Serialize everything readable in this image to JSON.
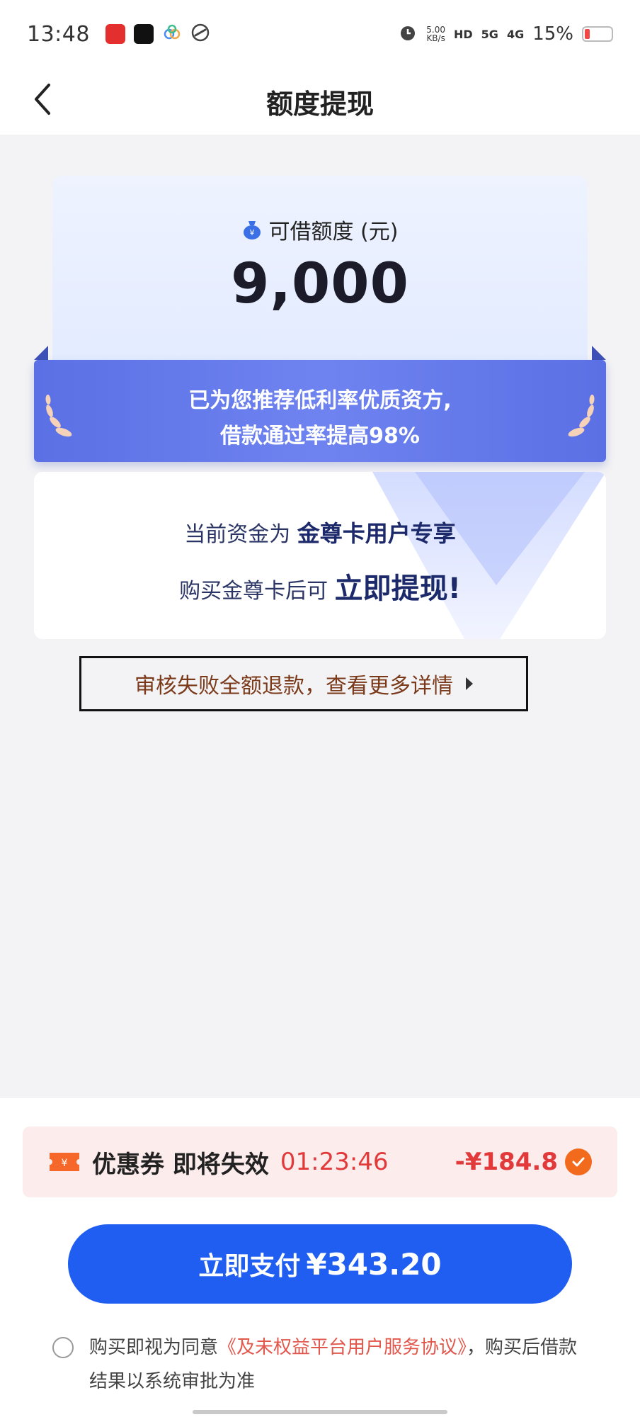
{
  "status_bar": {
    "time": "13:48",
    "net_speed_value": "5.00",
    "net_speed_unit": "KB/s",
    "hd_label": "HD",
    "sig1_label": "5G",
    "sig2_label": "4G",
    "battery_percent": "15%",
    "battery_level": 0.15,
    "apps": [
      "xiaohongshu-app-icon",
      "douyin-app-icon",
      "cloud-app-icon",
      "link-app-icon"
    ]
  },
  "header": {
    "title": "额度提现"
  },
  "limit_card": {
    "label": "可借额度 (元)",
    "amount": "9,000"
  },
  "ribbon": {
    "line1": "已为您推荐低利率优质资方,",
    "line2": "借款通过率提高98%"
  },
  "promo": {
    "line1_prefix": "当前资金为",
    "line1_highlight": "金尊卡用户专享",
    "line2_prefix": "购买金尊卡后可",
    "line2_highlight": "立即提现!"
  },
  "refund_link": {
    "label": "审核失败全额退款，查看更多详情"
  },
  "coupon": {
    "label": "优惠券 即将失效",
    "timer": "01:23:46",
    "discount": "-¥184.8"
  },
  "pay_button": {
    "label": "立即支付",
    "amount": "¥343.20"
  },
  "agreement": {
    "prefix": "购买即视为同意",
    "link": "《及未权益平台用户服务协议》",
    "suffix": "，购买后借款结果以系统审批为准"
  },
  "colors": {
    "primary_blue": "#1f5ef0",
    "ribbon_blue": "#5a70e4",
    "alert_red": "#e23a3a",
    "accent_orange": "#f26b1d",
    "link_brown": "#7a3a1a"
  }
}
